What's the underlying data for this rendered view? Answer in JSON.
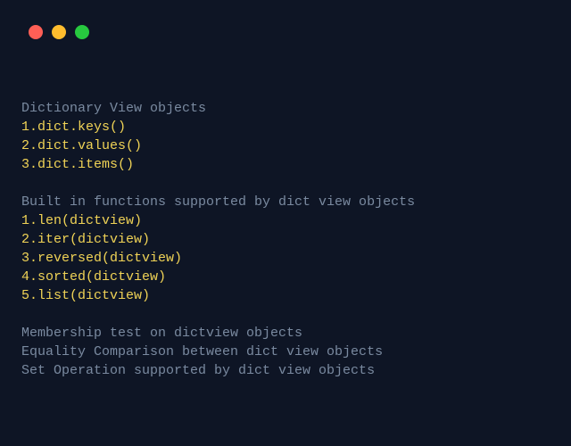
{
  "sections": [
    {
      "heading": "Dictionary View objects",
      "items": [
        "1.dict.keys()",
        "2.dict.values()",
        "3.dict.items()"
      ]
    },
    {
      "heading": "Built in functions supported by dict view objects",
      "items": [
        "1.len(dictview)",
        "2.iter(dictview)",
        "3.reversed(dictview)",
        "4.sorted(dictview)",
        "5.list(dictview)"
      ]
    }
  ],
  "footer_lines": [
    "Membership test on dictview objects",
    "Equality Comparison between dict view objects",
    "Set Operation supported by dict view objects"
  ]
}
